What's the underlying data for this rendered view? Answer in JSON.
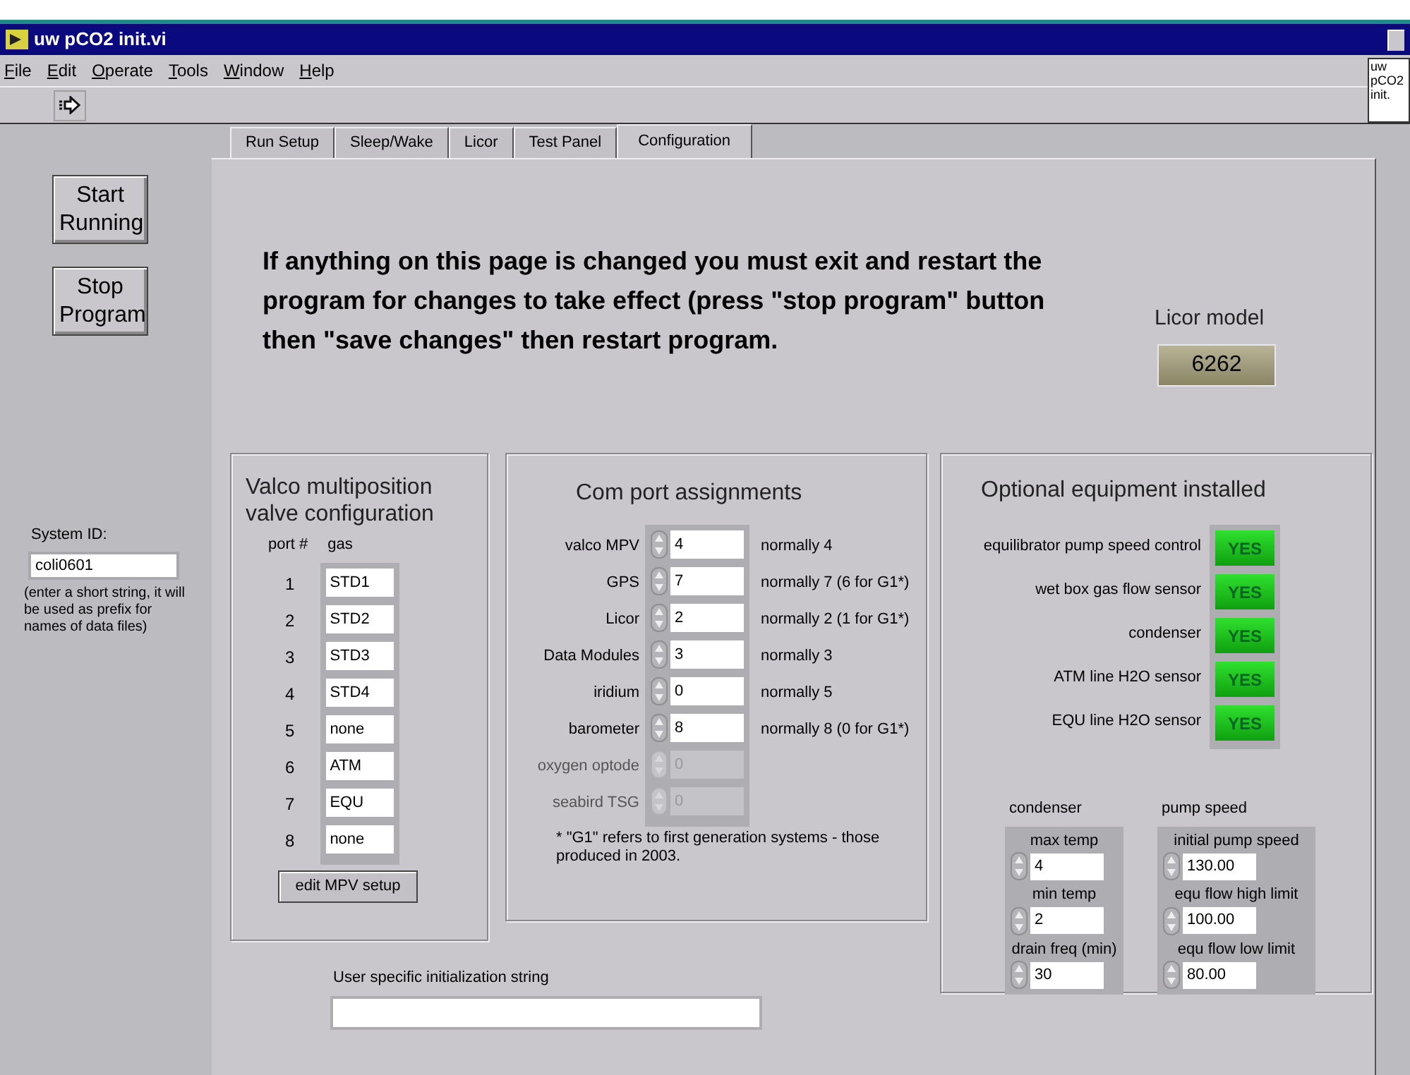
{
  "window": {
    "title": "uw pCO2 init.vi",
    "vi_icon_lines": [
      "uw",
      "pCO2",
      "init."
    ]
  },
  "menu": [
    "File",
    "Edit",
    "Operate",
    "Tools",
    "Window",
    "Help"
  ],
  "side_buttons": [
    "Start Running",
    "Stop Program"
  ],
  "system_id": {
    "label": "System ID:",
    "value": "coli0601",
    "note": "(enter a short string, it will be used as prefix for names of data files)"
  },
  "tabs": [
    {
      "label": "Run Setup",
      "selected": false
    },
    {
      "label": "Sleep/Wake",
      "selected": false
    },
    {
      "label": "Licor",
      "selected": false
    },
    {
      "label": "Test Panel",
      "selected": false
    },
    {
      "label": "Configuration",
      "selected": true
    }
  ],
  "notice": "If anything on this page is changed you must exit and restart the program for changes to take effect (press \"stop program\" button then \"save changes\" then restart program.",
  "licor_model": {
    "label": "Licor model",
    "value": "6262"
  },
  "valco": {
    "title": "Valco multiposition valve configuration",
    "port_header": "port #",
    "gas_header": "gas",
    "button": "edit MPV setup",
    "ports": [
      {
        "port": "1",
        "gas": "STD1"
      },
      {
        "port": "2",
        "gas": "STD2"
      },
      {
        "port": "3",
        "gas": "STD3"
      },
      {
        "port": "4",
        "gas": "STD4"
      },
      {
        "port": "5",
        "gas": "none"
      },
      {
        "port": "6",
        "gas": "ATM"
      },
      {
        "port": "7",
        "gas": "EQU"
      },
      {
        "port": "8",
        "gas": "none"
      }
    ]
  },
  "com_ports": {
    "title": "Com port assignments",
    "footnote": "* \"G1\" refers to first generation systems - those produced in 2003.",
    "rows": [
      {
        "label": "valco MPV",
        "value": "4",
        "note": "normally 4",
        "disabled": false
      },
      {
        "label": "GPS",
        "value": "7",
        "note": "normally 7 (6 for G1*)",
        "disabled": false
      },
      {
        "label": "Licor",
        "value": "2",
        "note": "normally 2 (1 for G1*)",
        "disabled": false
      },
      {
        "label": "Data Modules",
        "value": "3",
        "note": "normally 3",
        "disabled": false
      },
      {
        "label": "iridium",
        "value": "0",
        "note": "normally 5",
        "disabled": false
      },
      {
        "label": "barometer",
        "value": "8",
        "note": "normally 8 (0 for G1*)",
        "disabled": false
      },
      {
        "label": "oxygen optode",
        "value": "0",
        "disabled": true
      },
      {
        "label": "seabird TSG",
        "value": "0",
        "disabled": true
      }
    ]
  },
  "optional": {
    "title": "Optional equipment installed",
    "options": [
      {
        "label": "equilibrator pump speed control",
        "text": "YES",
        "on": true
      },
      {
        "label": "wet box gas flow sensor",
        "text": "YES",
        "on": true
      },
      {
        "label": "condenser",
        "text": "YES",
        "on": true
      },
      {
        "label": "ATM line H2O sensor",
        "text": "YES",
        "on": true
      },
      {
        "label": "EQU line H2O sensor",
        "text": "YES",
        "on": true
      }
    ],
    "groups": [
      {
        "title": "condenser",
        "fields": [
          {
            "label": "max temp",
            "value": "4"
          },
          {
            "label": "min temp",
            "value": "2"
          },
          {
            "label": "drain freq (min)",
            "value": "30"
          }
        ]
      },
      {
        "title": "pump speed",
        "fields": [
          {
            "label": "initial pump speed",
            "value": "130.00"
          },
          {
            "label": "equ flow high limit",
            "value": "100.00"
          },
          {
            "label": "equ flow low limit",
            "value": "80.00"
          }
        ]
      }
    ]
  },
  "user_string": {
    "label": "User specific initialization string"
  }
}
